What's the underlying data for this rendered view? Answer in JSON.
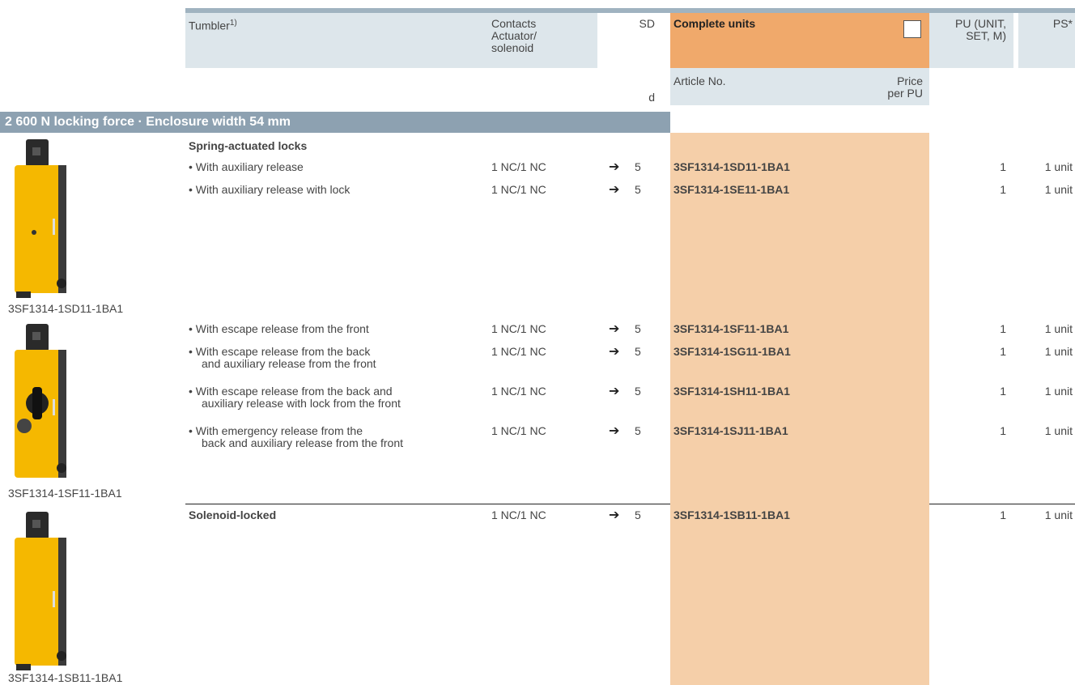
{
  "header": {
    "tumbler": "Tumbler",
    "tumbler_sup": "1)",
    "contacts_line1": "Contacts",
    "contacts_line2": "Actuator/",
    "contacts_line3": "solenoid",
    "sd": "SD",
    "sd_unit": "d",
    "complete_units": "Complete units",
    "article_no": "Article No.",
    "price_line1": "Price",
    "price_line2": "per PU",
    "pu_line1": "PU (UNIT,",
    "pu_line2": "SET, M)",
    "ps": "PS*"
  },
  "section": {
    "title": "2 600 N locking force · Enclosure width 54 mm"
  },
  "groups": {
    "spring": {
      "title": "Spring-actuated locks"
    },
    "solenoid": {
      "title": "Solenoid-locked"
    }
  },
  "rows": [
    {
      "desc1": "• With auxiliary release",
      "desc2": "",
      "contacts": "1 NC/1 NC",
      "arrow": "➔",
      "sd": "5",
      "article": "3SF1314-1SD11-1BA1",
      "pu": "1",
      "ps": "1 unit"
    },
    {
      "desc1": "• With auxiliary release with lock",
      "desc2": "",
      "contacts": "1 NC/1 NC",
      "arrow": "➔",
      "sd": "5",
      "article": "3SF1314-1SE11-1BA1",
      "pu": "1",
      "ps": "1 unit"
    },
    {
      "desc1": "• With escape release from the front",
      "desc2": "",
      "contacts": "1 NC/1 NC",
      "arrow": "➔",
      "sd": "5",
      "article": "3SF1314-1SF11-1BA1",
      "pu": "1",
      "ps": "1 unit"
    },
    {
      "desc1": "• With escape release from the back",
      "desc2": "and auxiliary release from the front",
      "contacts": "1 NC/1 NC",
      "arrow": "➔",
      "sd": "5",
      "article": "3SF1314-1SG11-1BA1",
      "pu": "1",
      "ps": "1 unit"
    },
    {
      "desc1": "• With escape release from the back and",
      "desc2": "auxiliary release with lock from the front",
      "contacts": "1 NC/1 NC",
      "arrow": "➔",
      "sd": "5",
      "article": "3SF1314-1SH11-1BA1",
      "pu": "1",
      "ps": "1 unit"
    },
    {
      "desc1": "• With emergency release from the",
      "desc2": "back and auxiliary release from the front",
      "contacts": "1 NC/1 NC",
      "arrow": "➔",
      "sd": "5",
      "article": "3SF1314-1SJ11-1BA1",
      "pu": "1",
      "ps": "1 unit"
    },
    {
      "desc1": "",
      "desc2": "",
      "contacts": "1 NC/1 NC",
      "arrow": "➔",
      "sd": "5",
      "article": "3SF1314-1SB11-1BA1",
      "pu": "1",
      "ps": "1 unit"
    }
  ],
  "images": [
    {
      "caption": "3SF1314-1SD11-1BA1"
    },
    {
      "caption": "3SF1314-1SF11-1BA1"
    },
    {
      "caption": "3SF1314-1SB11-1BA1"
    }
  ],
  "colors": {
    "header_bg": "#dde6eb",
    "section_bar": "#8da1b1",
    "orange_head": "#f0a96b",
    "orange_col": "#f5cfa9",
    "device_yellow": "#f5b800",
    "device_black": "#2a2a2a"
  }
}
